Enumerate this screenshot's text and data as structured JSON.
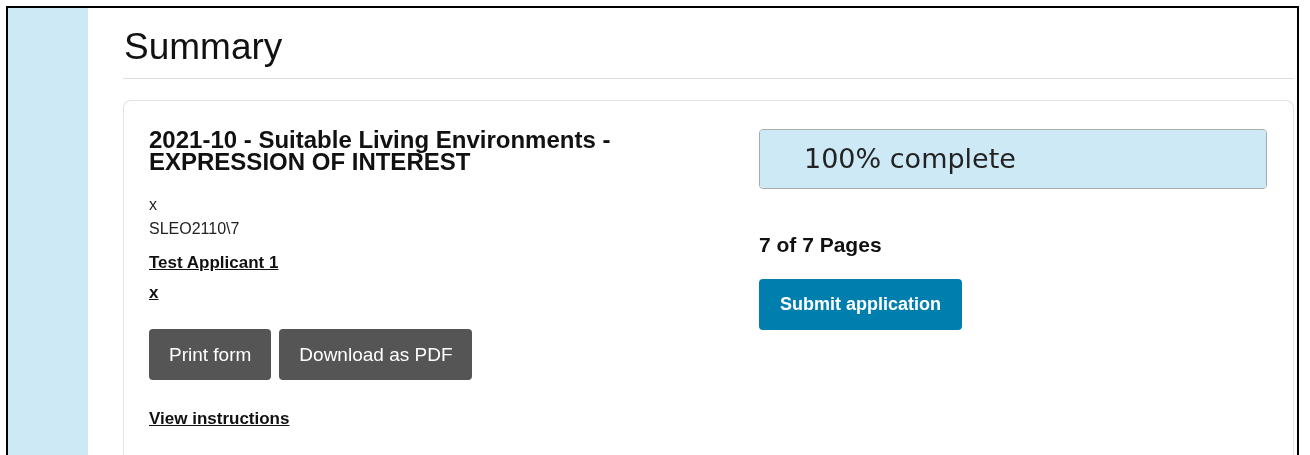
{
  "heading": "Summary",
  "application": {
    "title": "2021-10 - Suitable Living Environments - EXPRESSION OF INTEREST",
    "detail_1": "x",
    "reference": "SLEO2110\\7",
    "applicant": "Test Applicant 1",
    "applicant_detail": "x",
    "buttons": [
      "Print form",
      "Download as PDF"
    ],
    "instructions_link": "View instructions"
  },
  "progress": {
    "label": "100% complete",
    "level": 1,
    "pages": "7 of 7 Pages",
    "submit": "Submit application"
  }
}
